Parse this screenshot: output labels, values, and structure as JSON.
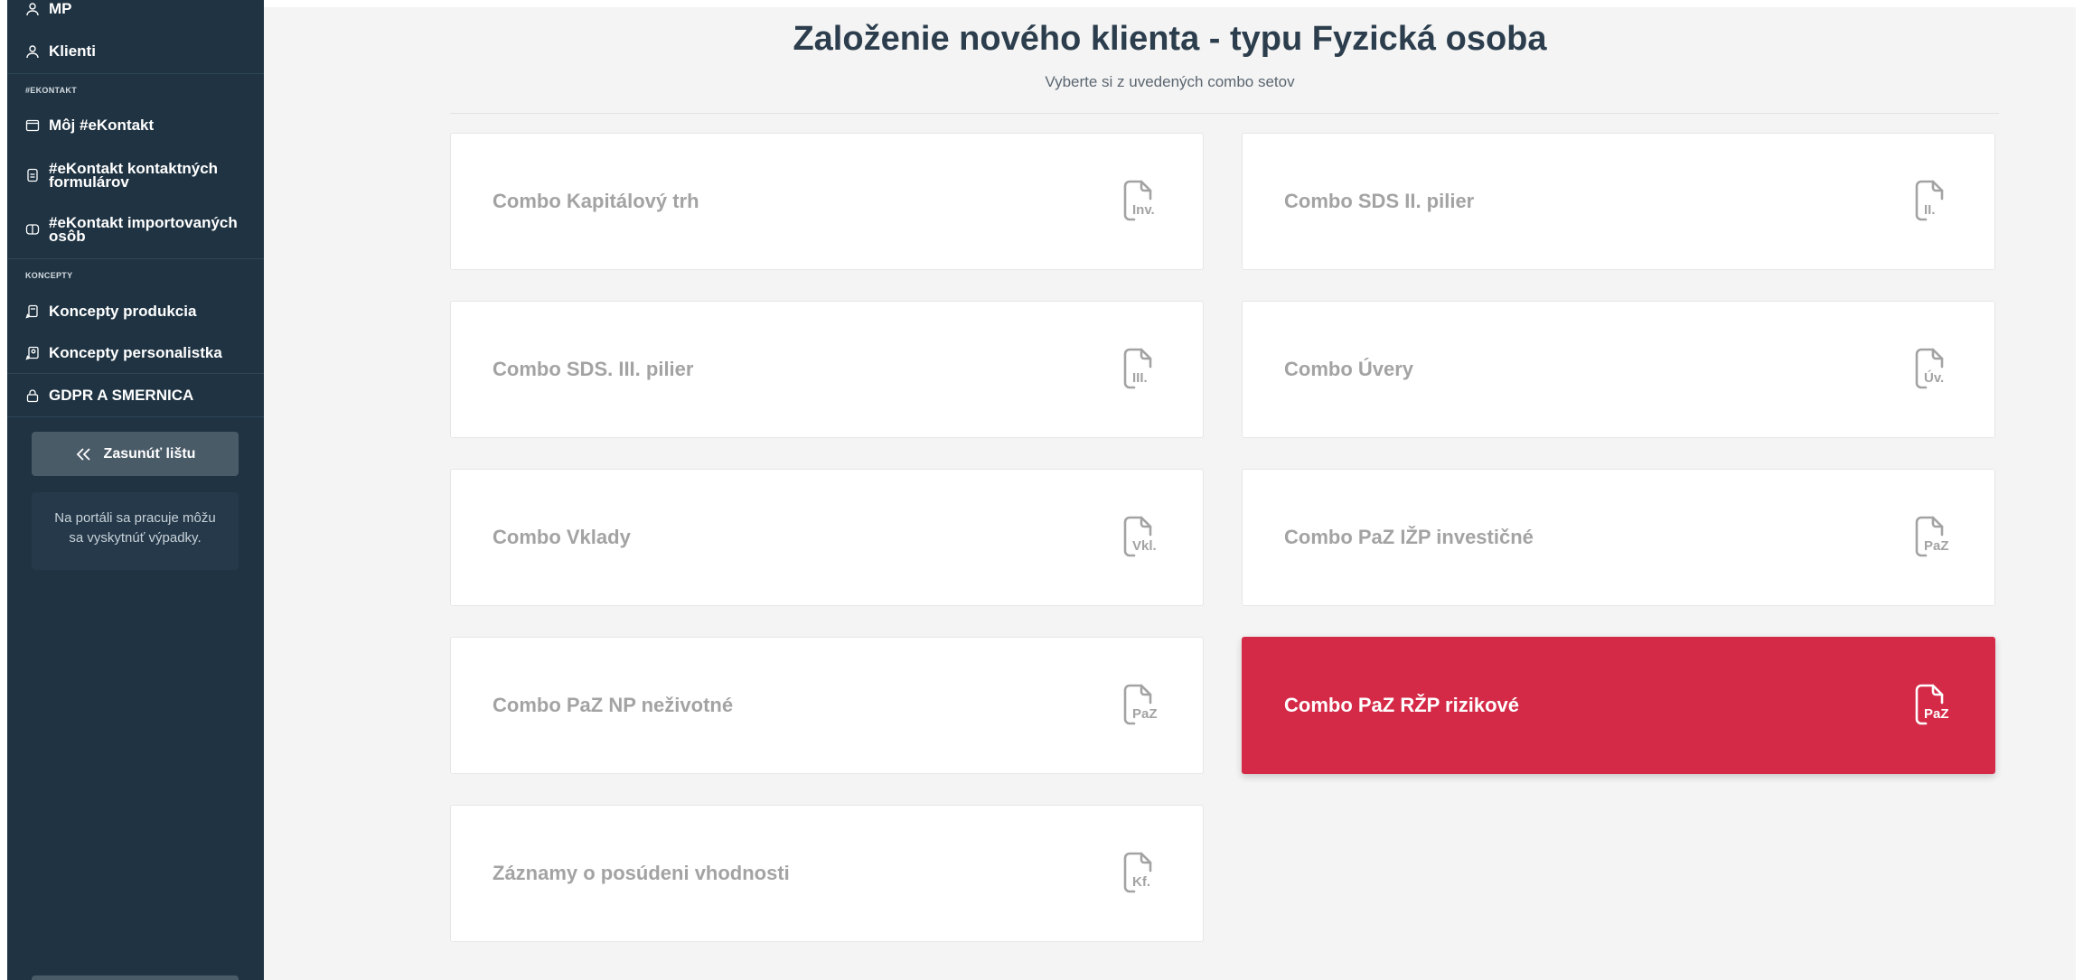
{
  "sidebar": {
    "top_item": "MP",
    "clients_item": "Klienti",
    "section_ekontakt": "#EKONTAKT",
    "ekontakt_items": [
      {
        "label_lines": [
          "Môj #eKontakt"
        ],
        "icon": "window-icon"
      },
      {
        "label_lines": [
          "#eKontakt kontaktných",
          "formulárov"
        ],
        "icon": "document-icon"
      },
      {
        "label_lines": [
          "#eKontakt importovaných",
          "osôb"
        ],
        "icon": "book-icon"
      }
    ],
    "section_koncepty": "KONCEPTY",
    "koncepty_items": [
      {
        "label": "Koncepty produkcia",
        "icon": "document-edit-icon"
      },
      {
        "label": "Koncepty personalistka",
        "icon": "document-person-icon"
      }
    ],
    "gdpr_item": "GDPR A SMERNICA",
    "collapse_label": "Zasunúť lištu",
    "notice_lines": [
      "Na portáli sa pracuje môžu",
      "sa vyskytnúť výpadky."
    ]
  },
  "main": {
    "title": "Založenie nového klienta - typu Fyzická osoba",
    "subtitle": "Vyberte si z uvedených combo setov",
    "cards": [
      {
        "label": "Combo Kapitálový trh",
        "abbr": "Inv.",
        "active": false
      },
      {
        "label": "Combo SDS II. pilier",
        "abbr": "II.",
        "active": false
      },
      {
        "label": "Combo SDS. III. pilier",
        "abbr": "III.",
        "active": false
      },
      {
        "label": "Combo Úvery",
        "abbr": "Úv.",
        "active": false
      },
      {
        "label": "Combo Vklady",
        "abbr": "Vkl.",
        "active": false
      },
      {
        "label": "Combo PaZ IŽP investičné",
        "abbr": "PaZ",
        "active": false
      },
      {
        "label": "Combo PaZ NP neživotné",
        "abbr": "PaZ",
        "active": false
      },
      {
        "label": "Combo PaZ RŽP rizikové",
        "abbr": "PaZ",
        "active": true
      },
      {
        "label": "Záznamy o posúdeni vhodnosti",
        "abbr": "Kf.",
        "active": false
      }
    ]
  },
  "colors": {
    "sidebar_bg": "#1f3342",
    "active_card": "#d42a47",
    "title": "#2c3e4d",
    "card_text": "#a3a3a3"
  }
}
